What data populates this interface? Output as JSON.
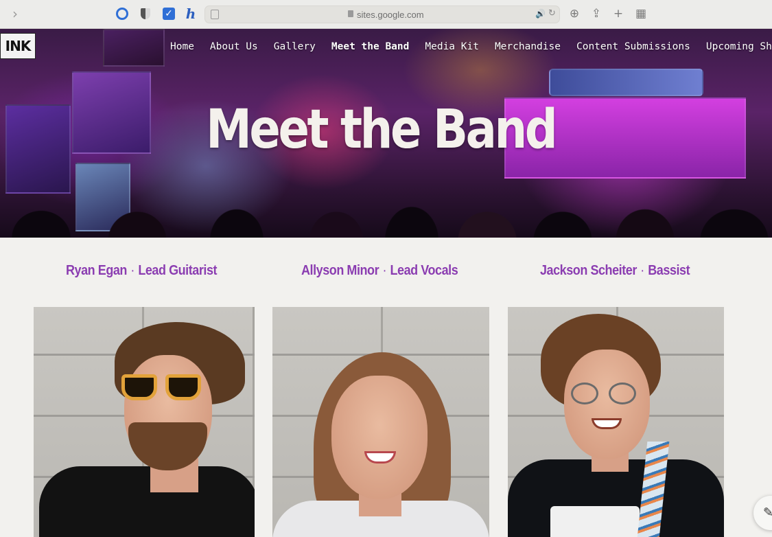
{
  "browser": {
    "url": "sites.google.com",
    "back_glyph": "›",
    "reload_glyph": "↻",
    "audio_glyph": "🔊",
    "check_glyph": "✓",
    "h_glyph": "h",
    "toolbar_glyphs": {
      "download": "⊕",
      "share": "⇪",
      "new_tab": "+",
      "tabs": "▦"
    },
    "icons": [
      "back-chevron-icon",
      "ring-extension-icon",
      "shield-extension-icon",
      "checkbox-extension-icon",
      "h-extension-icon",
      "page-icon",
      "lock-icon",
      "audio-icon",
      "reload-icon",
      "download-icon",
      "share-icon",
      "new-tab-icon",
      "tab-overview-icon"
    ],
    "accent": "#2f6fd6"
  },
  "site": {
    "logo_text": "INK",
    "nav": [
      {
        "label": "Home"
      },
      {
        "label": "About Us"
      },
      {
        "label": "Gallery"
      },
      {
        "label": "Meet the Band",
        "active": true
      },
      {
        "label": "Media Kit"
      },
      {
        "label": "Merchandise"
      },
      {
        "label": "Content Submissions"
      },
      {
        "label": "Upcoming Shows"
      }
    ],
    "hero_title": "Meet the Band",
    "heading_color": "#8b3db1"
  },
  "members": [
    {
      "name": "Ryan Egan",
      "separator": "·",
      "role": "Lead Guitarist"
    },
    {
      "name": "Allyson Minor",
      "separator": "·",
      "role": "Lead Vocals"
    },
    {
      "name": "Jackson Scheiter",
      "separator": "·",
      "role": "Bassist"
    }
  ],
  "fab": {
    "icon": "edit-pencil-icon",
    "glyph": "✎"
  }
}
